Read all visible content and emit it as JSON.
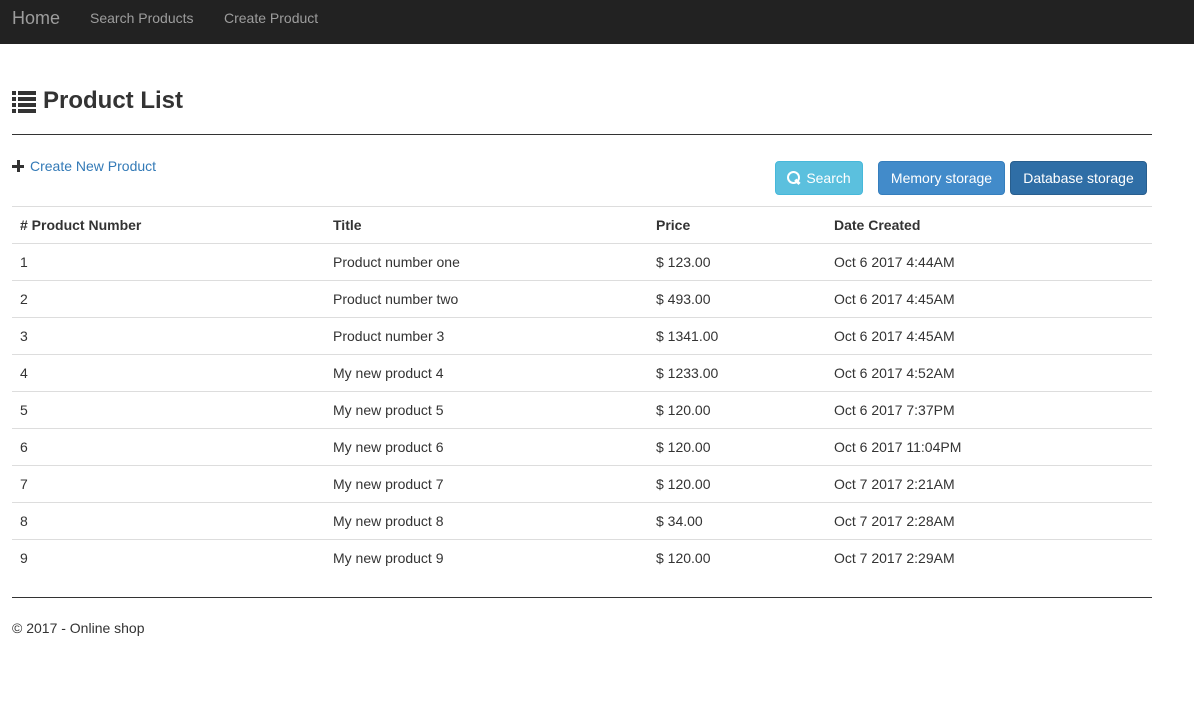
{
  "navbar": {
    "brand": "Home",
    "links": [
      "Search Products",
      "Create Product"
    ]
  },
  "header": {
    "icon": "list-icon",
    "title": "Product List"
  },
  "actions": {
    "create_link": "Create New Product",
    "create_icon": "plus-icon",
    "search_button": "Search",
    "search_icon": "search-icon",
    "memory_button": "Memory storage",
    "database_button": "Database storage"
  },
  "table": {
    "headers": [
      "# Product Number",
      "Title",
      "Price",
      "Date Created"
    ],
    "rows": [
      [
        "1",
        "Product number one",
        "$ 123.00",
        "Oct 6 2017 4:44AM"
      ],
      [
        "2",
        "Product number two",
        "$ 493.00",
        "Oct 6 2017 4:45AM"
      ],
      [
        "3",
        "Product number 3",
        "$ 1341.00",
        "Oct 6 2017 4:45AM"
      ],
      [
        "4",
        "My new product 4",
        "$ 1233.00",
        "Oct 6 2017 4:52AM"
      ],
      [
        "5",
        "My new product 5",
        "$ 120.00",
        "Oct 6 2017 7:37PM"
      ],
      [
        "6",
        "My new product 6",
        "$ 120.00",
        "Oct 6 2017 11:04PM"
      ],
      [
        "7",
        "My new product 7",
        "$ 120.00",
        "Oct 7 2017 2:21AM"
      ],
      [
        "8",
        "My new product 8",
        "$ 34.00",
        "Oct 7 2017 2:28AM"
      ],
      [
        "9",
        "My new product 9",
        "$ 120.00",
        "Oct 7 2017 2:29AM"
      ]
    ]
  },
  "footer": {
    "text": "© 2017 - Online shop"
  },
  "colors": {
    "navbar_bg": "#222222",
    "link": "#337ab7",
    "btn_info": "#5bc0de",
    "btn_primary": "#428bca",
    "btn_primary_active": "#2f6ea6"
  }
}
